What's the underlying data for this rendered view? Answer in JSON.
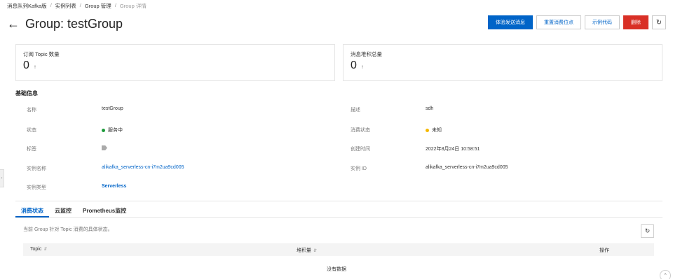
{
  "breadcrumb": {
    "items": [
      "消息队列Kafka版",
      "实例列表",
      "Group 管理"
    ],
    "current": "Group 详情"
  },
  "header": {
    "back_icon": "arrow-left-icon",
    "title": "Group: testGroup"
  },
  "actions": {
    "send_message": "体验发送消息",
    "reset_offset": "重置消费位点",
    "sample_code": "示例代码",
    "delete": "删除",
    "refresh_icon": "refresh-icon"
  },
  "stats": {
    "subscribed_topics": {
      "label": "订阅 Topic 数量",
      "value": "0"
    },
    "message_backlog": {
      "label": "消息堆积总量",
      "value": "0"
    },
    "trend_icon": "arrow-up-icon"
  },
  "basic_info": {
    "title": "基础信息",
    "name_label": "名称",
    "name_value": "testGroup",
    "desc_label": "描述",
    "desc_value": "sdh",
    "status_label": "状态",
    "status_value": "服务中",
    "consume_status_label": "消费状态",
    "consume_status_value": "未知",
    "tag_label": "标签",
    "created_label": "创建时间",
    "created_value": "2022年8月24日 10:58:51",
    "instance_name_label": "实例名称",
    "instance_name_value": "alikafka_serverless-cn-i7m2ua9cd005",
    "instance_id_label": "实例 ID",
    "instance_id_value": "alikafka_serverless-cn-i7m2ua9cd005",
    "instance_type_label": "实例类型",
    "instance_type_value": "Serverless",
    "status_colors": {
      "running": "#1e9b3b",
      "unknown": "#f5b800"
    }
  },
  "tabs": [
    {
      "label": "消费状态",
      "active": true
    },
    {
      "label": "云监控",
      "active": false
    },
    {
      "label": "Prometheus监控",
      "active": false
    }
  ],
  "consume_tab": {
    "description": "当前 Group 针对 Topic 消费的具体状态。",
    "columns": {
      "topic": "Topic",
      "backlog": "堆积量",
      "actions": "操作"
    },
    "empty_text": "没有数据"
  },
  "colors": {
    "accent": "#0064c8",
    "danger": "#d93026"
  }
}
